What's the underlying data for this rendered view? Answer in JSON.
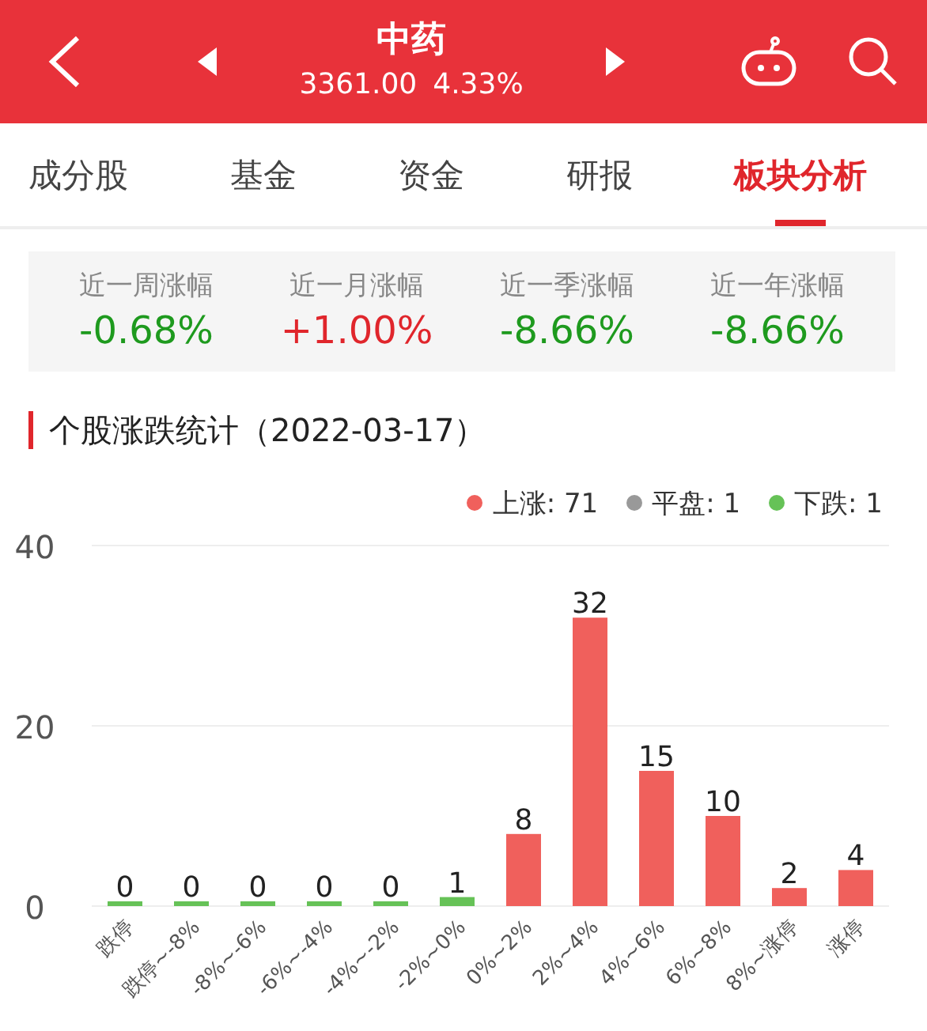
{
  "header": {
    "title": "中药",
    "price": "3361.00",
    "change": "4.33%"
  },
  "tabs": [
    {
      "label": "成分股",
      "selected": false
    },
    {
      "label": "基金",
      "selected": false
    },
    {
      "label": "资金",
      "selected": false
    },
    {
      "label": "研报",
      "selected": false
    },
    {
      "label": "板块分析",
      "selected": true
    }
  ],
  "stats": [
    {
      "label": "近一周涨幅",
      "value": "-0.68%",
      "color": "#1e9a1e"
    },
    {
      "label": "近一月涨幅",
      "value": "+1.00%",
      "color": "#e0262c"
    },
    {
      "label": "近一季涨幅",
      "value": "-8.66%",
      "color": "#1e9a1e"
    },
    {
      "label": "近一年涨幅",
      "value": "-8.66%",
      "color": "#1e9a1e"
    }
  ],
  "section": {
    "title": "个股涨跌统计（2022-03-17）"
  },
  "legend": [
    {
      "label": "上涨: 71",
      "color": "#f0605c"
    },
    {
      "label": "平盘: 1",
      "color": "#999999"
    },
    {
      "label": "下跌: 1",
      "color": "#66c257"
    }
  ],
  "chart_data": {
    "type": "bar",
    "categories": [
      "跌停",
      "跌停~-8%",
      "-8%~-6%",
      "-6%~-4%",
      "-4%~-2%",
      "-2%~0%",
      "0%~2%",
      "2%~4%",
      "4%~6%",
      "6%~8%",
      "8%~涨停",
      "涨停"
    ],
    "series": [
      {
        "color": "#66c257",
        "values": [
          0,
          0,
          0,
          0,
          0,
          1,
          null,
          null,
          null,
          null,
          null,
          null
        ]
      },
      {
        "color": "#f0605c",
        "values": [
          null,
          null,
          null,
          null,
          null,
          null,
          8,
          32,
          15,
          10,
          2,
          4
        ]
      }
    ],
    "stacked": true,
    "ylim": [
      0,
      40
    ],
    "yticks": [
      0,
      20,
      40
    ],
    "data_labels": true
  }
}
